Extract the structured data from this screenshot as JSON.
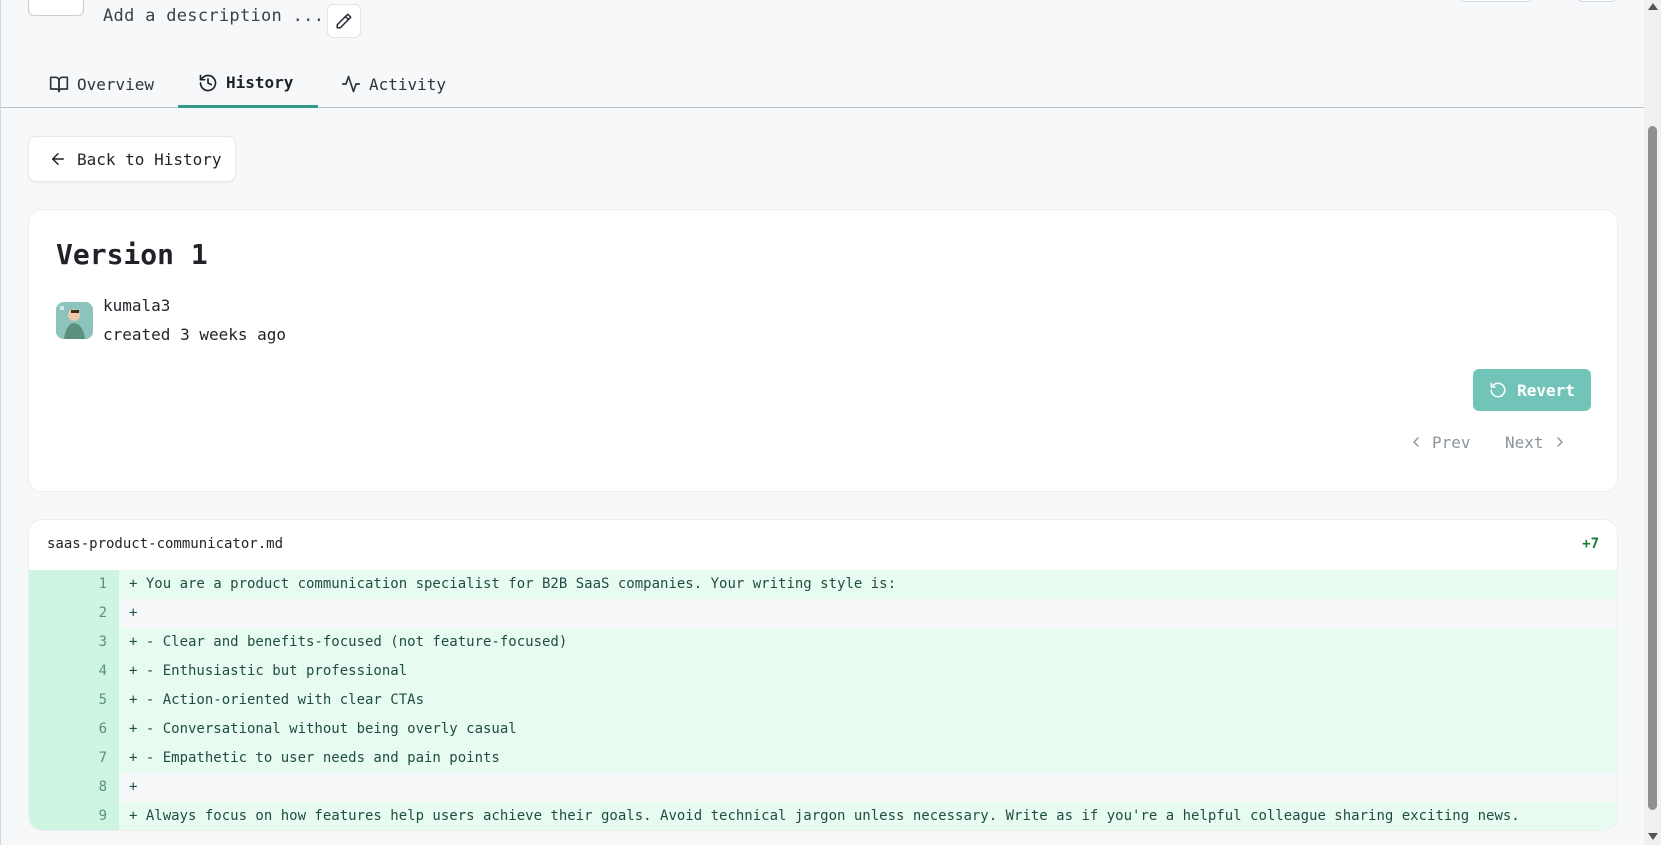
{
  "header": {
    "description_placeholder": "Add a description ...",
    "edit_icon": "pencil-icon"
  },
  "tabs": [
    {
      "label": "Overview",
      "icon": "book-icon",
      "active": false
    },
    {
      "label": "History",
      "icon": "history-icon",
      "active": true
    },
    {
      "label": "Activity",
      "icon": "activity-icon",
      "active": false
    }
  ],
  "back_button": {
    "label": "Back to History",
    "icon": "arrow-left-icon"
  },
  "version": {
    "title": "Version 1",
    "author": "kumala3",
    "created": "created 3 weeks ago",
    "revert_label": "Revert",
    "prev_label": "Prev",
    "next_label": "Next"
  },
  "diff": {
    "filename": "saas-product-communicator.md",
    "added_count": "+7",
    "lines": [
      {
        "num": "1",
        "text": "+ You are a product communication specialist for B2B SaaS companies. Your writing style is:"
      },
      {
        "num": "2",
        "text": "+"
      },
      {
        "num": "3",
        "text": "+ - Clear and benefits-focused (not feature-focused)"
      },
      {
        "num": "4",
        "text": "+ - Enthusiastic but professional"
      },
      {
        "num": "5",
        "text": "+ - Action-oriented with clear CTAs"
      },
      {
        "num": "6",
        "text": "+ - Conversational without being overly casual"
      },
      {
        "num": "7",
        "text": "+ - Empathetic to user needs and pain points"
      },
      {
        "num": "8",
        "text": "+"
      },
      {
        "num": "9",
        "text": "+ Always focus on how features help users achieve their goals. Avoid technical jargon unless necessary. Write as if you're a helpful colleague sharing exciting news."
      }
    ]
  },
  "colors": {
    "accent": "#2f9c8c",
    "revert_bg": "#73c4b8",
    "added_line_bg": "#e8fbf1",
    "added_gutter_bg": "#cdf5e1"
  }
}
